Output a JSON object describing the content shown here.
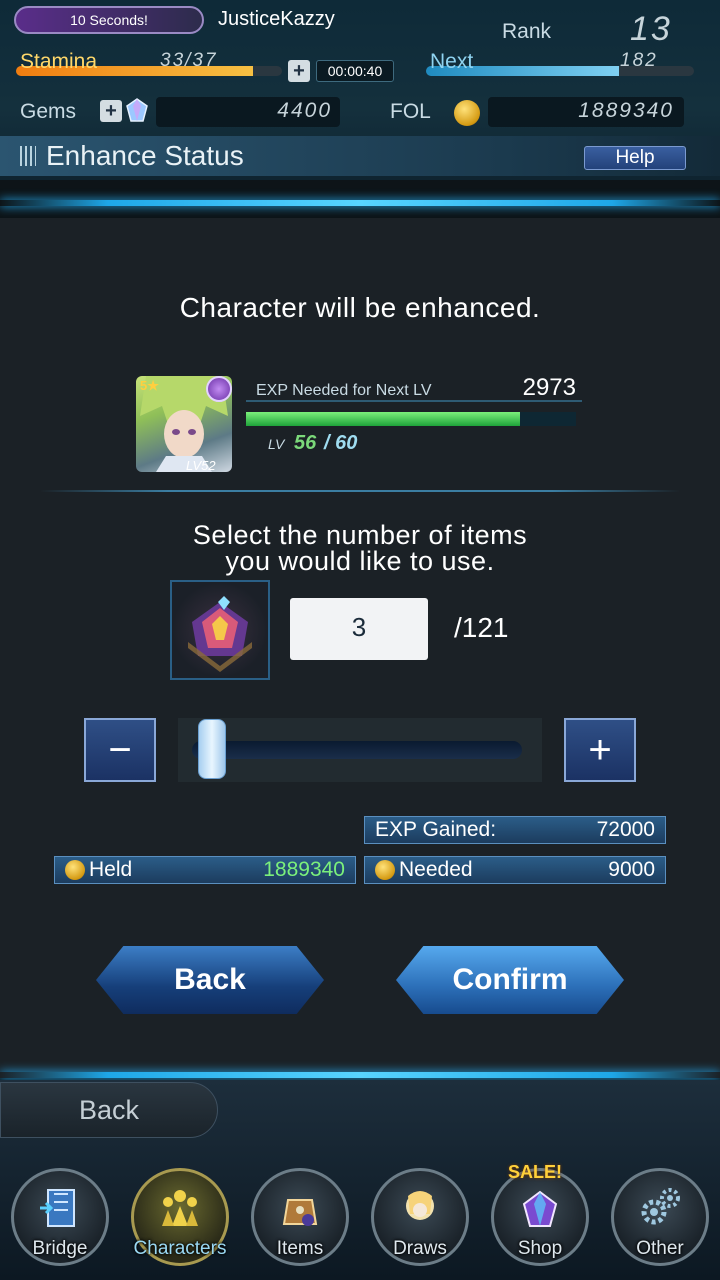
{
  "header": {
    "event_pill": "10 Seconds!",
    "username": "JusticeKazzy",
    "rank_label": "Rank",
    "rank_value": "13",
    "stamina_label": "Stamina",
    "stamina_value": "33/37",
    "stamina_fraction": 0.89,
    "stamina_timer": "00:00:40",
    "next_label": "Next",
    "next_value": "182",
    "next_fraction": 0.72,
    "gems_label": "Gems",
    "gems_value": "4400",
    "fol_label": "FOL",
    "fol_value": "1889340"
  },
  "title_bar": {
    "title": "Enhance Status",
    "help_label": "Help"
  },
  "enhance": {
    "message": "Character will be enhanced.",
    "character": {
      "rarity": "5★",
      "level_badge": "LV52",
      "exp_label": "EXP Needed for Next LV",
      "exp_value": "2973",
      "exp_fraction": 0.83,
      "lv_label": "LV",
      "lv_current": "56",
      "lv_max": "/ 60"
    },
    "select_prompt_1": "Select the number of items",
    "select_prompt_2": "you would like to use.",
    "quantity": "3",
    "quantity_max": "/121",
    "slider_fraction": 0.025,
    "minus_label": "−",
    "plus_label": "+",
    "exp_gained_label": "EXP Gained:",
    "exp_gained_value": "72000",
    "held_label": "Held",
    "held_value": "1889340",
    "needed_label": "Needed",
    "needed_value": "9000",
    "back_label": "Back",
    "confirm_label": "Confirm"
  },
  "footer": {
    "back_label": "Back",
    "sale_badge": "SALE!",
    "nav": [
      {
        "label": "Bridge",
        "icon": "bridge-door-icon"
      },
      {
        "label": "Characters",
        "icon": "characters-group-icon"
      },
      {
        "label": "Items",
        "icon": "items-bag-icon"
      },
      {
        "label": "Draws",
        "icon": "draws-crystal-icon"
      },
      {
        "label": "Shop",
        "icon": "shop-gem-icon"
      },
      {
        "label": "Other",
        "icon": "gears-icon"
      }
    ]
  },
  "colors": {
    "accent_glow": "#27b5ff",
    "held_value_color": "#7bf07b",
    "stamina_label_color": "#ffd86a",
    "next_label_color": "#8fd3f0"
  }
}
